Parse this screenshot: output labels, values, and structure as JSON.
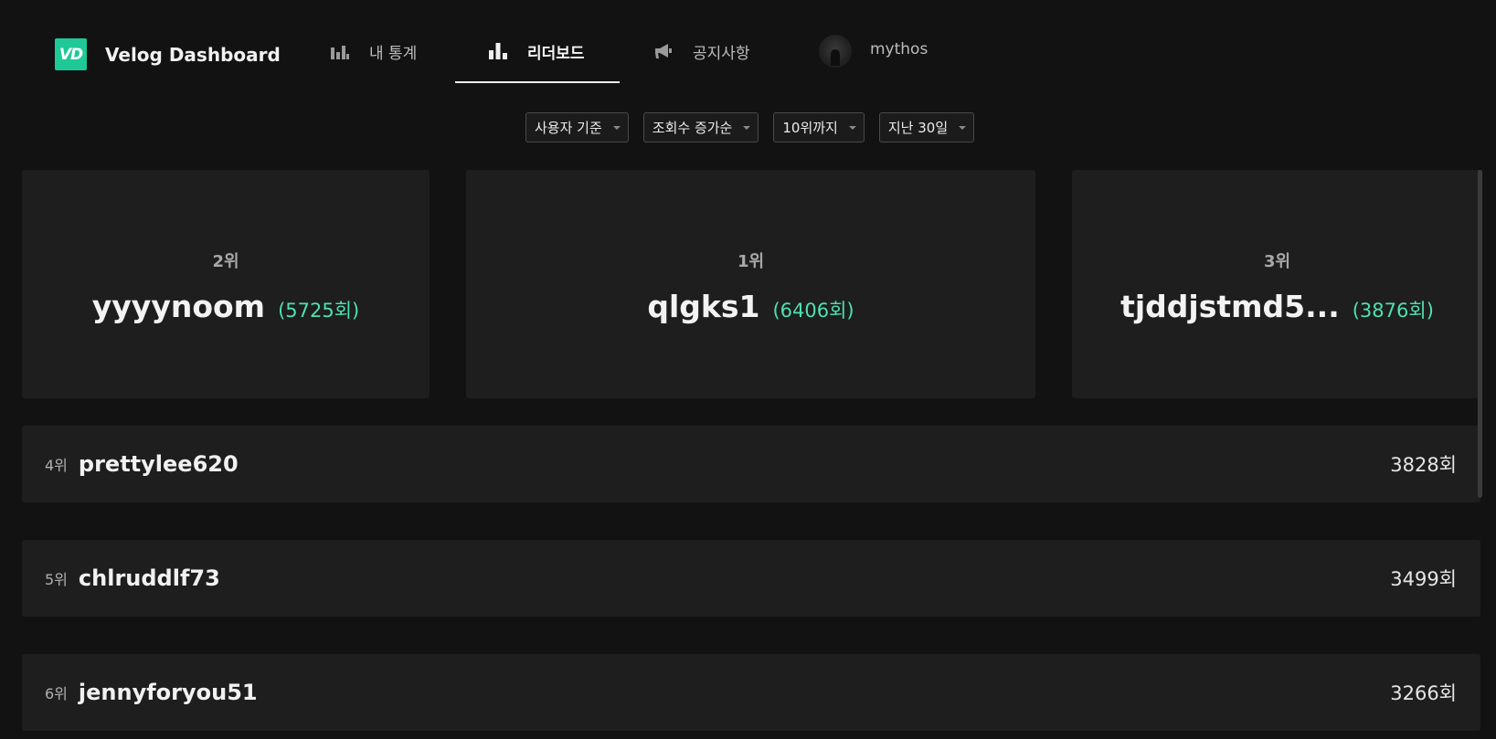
{
  "header": {
    "logo_text": "VD",
    "brand_title": "Velog Dashboard",
    "nav": [
      {
        "label": "내 통계",
        "icon": "bar-chart-icon",
        "active": false
      },
      {
        "label": "리더보드",
        "icon": "leaderboard-icon",
        "active": true
      },
      {
        "label": "공지사항",
        "icon": "megaphone-icon",
        "active": false
      }
    ],
    "user": {
      "name": "mythos",
      "icon": "avatar"
    },
    "accent_color": "#1ec997"
  },
  "filters": [
    {
      "label": "사용자 기준"
    },
    {
      "label": "조회수 증가순"
    },
    {
      "label": "10위까지"
    },
    {
      "label": "지난 30일"
    }
  ],
  "podium": [
    {
      "rank": "2위",
      "name": "yyyynoom",
      "count": "(5725회)"
    },
    {
      "rank": "1위",
      "name": "qlgks1",
      "count": "(6406회)"
    },
    {
      "rank": "3위",
      "name": "tjddjstmd5...",
      "count": "(3876회)"
    }
  ],
  "rows": [
    {
      "rank": "4위",
      "name": "prettylee620",
      "count": "3828회"
    },
    {
      "rank": "5위",
      "name": "chlruddlf73",
      "count": "3499회"
    },
    {
      "rank": "6위",
      "name": "jennyforyou51",
      "count": "3266회"
    }
  ],
  "colors": {
    "background": "#121212",
    "card": "#1e1e1e",
    "count_accent": "#4fe0b0"
  }
}
